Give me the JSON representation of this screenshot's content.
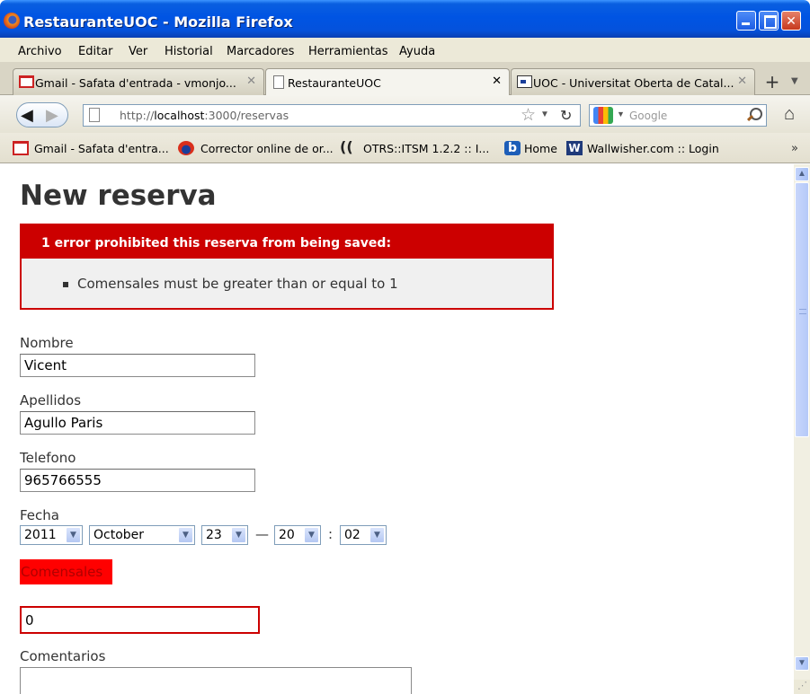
{
  "window": {
    "title": "RestauranteUOC - Mozilla Firefox"
  },
  "menu": [
    "Archivo",
    "Editar",
    "Ver",
    "Historial",
    "Marcadores",
    "Herramientas",
    "Ayuda"
  ],
  "tabs": [
    {
      "label": "Gmail - Safata d'entrada - vmonjo...",
      "icon": "gmail-icon"
    },
    {
      "label": "RestauranteUOC",
      "icon": "page-icon"
    },
    {
      "label": "UOC - Universitat Oberta de Catal...",
      "icon": "uoc-icon"
    }
  ],
  "nav": {
    "url_prefix": "http://",
    "url_host": "localhost",
    "url_rest": ":3000/reservas",
    "search_placeholder": "Google"
  },
  "bookmarks": [
    "Gmail - Safata d'entra...",
    "Corrector online de or...",
    "OTRS::ITSM 1.2.2 :: I...",
    "Home",
    "Wallwisher.com :: Login"
  ],
  "page": {
    "title": "New reserva",
    "error_header": "1 error prohibited this reserva from being saved:",
    "error_item": "Comensales must be greater than or equal to 1",
    "fields": {
      "nombre": {
        "label": "Nombre",
        "value": "Vicent"
      },
      "apellidos": {
        "label": "Apellidos",
        "value": "Agullo Paris"
      },
      "telefono": {
        "label": "Telefono",
        "value": "965766555"
      },
      "fecha": {
        "label": "Fecha",
        "year": "2011",
        "month": "October",
        "day": "23",
        "hour": "20",
        "minute": "02",
        "date_time_sep": "—",
        "time_sep": ":"
      },
      "comensales": {
        "label": "Comensales",
        "value": "0"
      },
      "comentarios": {
        "label": "Comentarios",
        "value": ""
      }
    }
  },
  "colors": {
    "error_red": "#cc0000",
    "title_blue": "#0054e3"
  }
}
